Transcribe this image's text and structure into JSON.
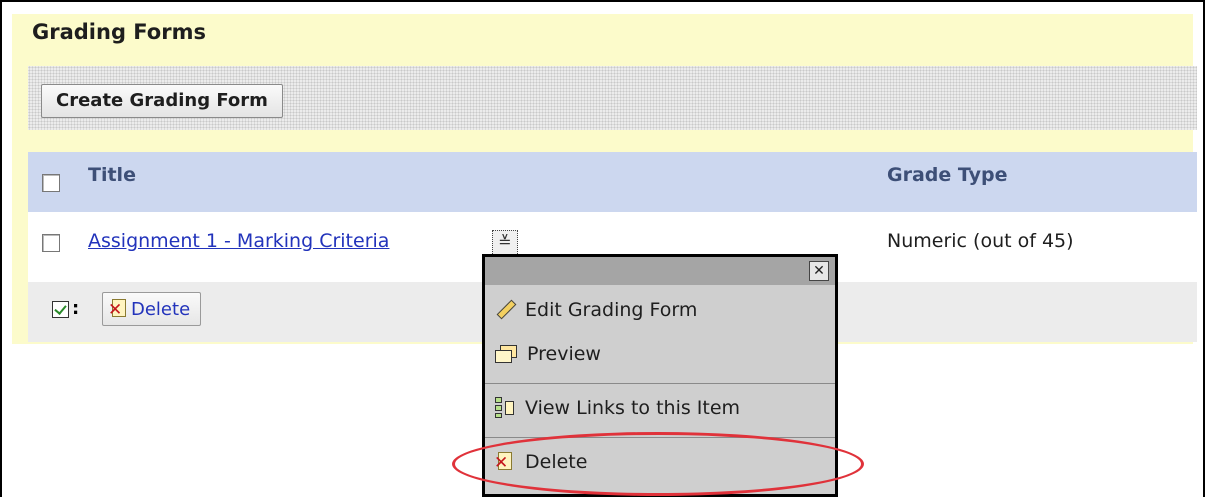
{
  "panel": {
    "title": "Grading Forms"
  },
  "toolbar": {
    "create_label": "Create Grading Form"
  },
  "table": {
    "columns": [
      "Title",
      "Grade Type"
    ],
    "rows": [
      {
        "title": "Assignment 1 - Marking Criteria",
        "grade_type": "Numeric (out of 45)"
      }
    ]
  },
  "footer": {
    "colon": ":",
    "delete_label": "Delete"
  },
  "context_menu": {
    "close_glyph": "✕",
    "items": [
      {
        "label": "Edit Grading Form",
        "icon": "pencil-icon"
      },
      {
        "label": "Preview",
        "icon": "preview-icon"
      },
      {
        "label": "View Links to this Item",
        "icon": "links-icon"
      },
      {
        "label": "Delete",
        "icon": "delete-doc-icon",
        "highlighted": true
      }
    ]
  },
  "colors": {
    "panel_bg": "#fcfbcb",
    "header_bg": "#ccd7ef",
    "header_text": "#3d4f77",
    "link": "#2233bb",
    "highlight": "#e0323a"
  }
}
